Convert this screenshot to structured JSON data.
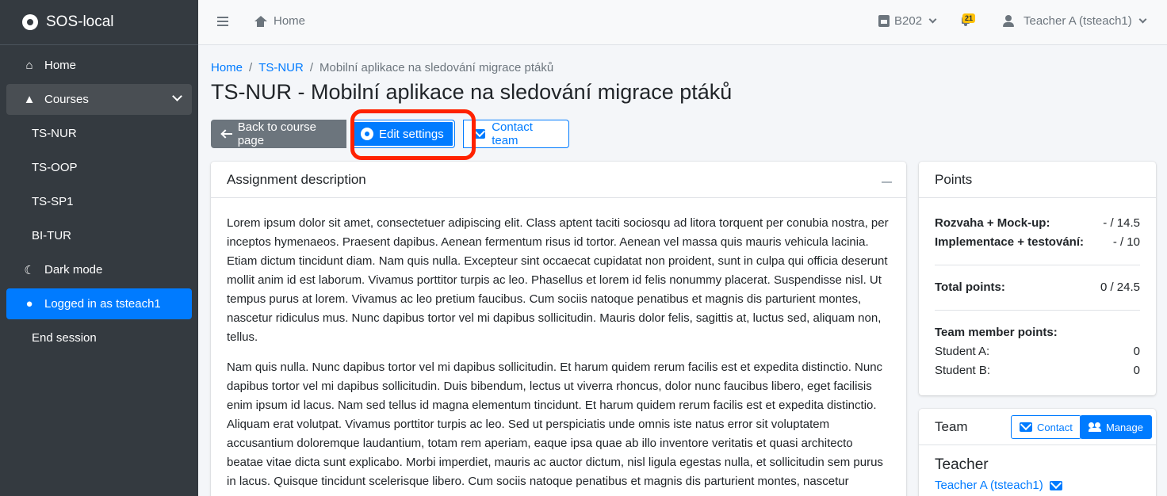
{
  "app": {
    "name": "SOS-local"
  },
  "sidebar": {
    "items": [
      {
        "label": "Home",
        "icon": "home-icon"
      },
      {
        "label": "Courses",
        "icon": "graduation-cap-icon"
      },
      {
        "label": "TS-NUR"
      },
      {
        "label": "TS-OOP"
      },
      {
        "label": "TS-SP1"
      },
      {
        "label": "BI-TUR"
      },
      {
        "label": "Dark mode",
        "icon": "moon-icon"
      },
      {
        "label": "Logged in as tsteach1",
        "icon": "user-cog-icon"
      },
      {
        "label": "End session"
      }
    ]
  },
  "topbar": {
    "home_label": "Home",
    "classroom": "B202",
    "notification_count": "21",
    "user_label": "Teacher A (tsteach1)"
  },
  "breadcrumb": {
    "items": [
      "Home",
      "TS-NUR",
      "Mobilní aplikace na sledování migrace ptáků"
    ],
    "separator": "/"
  },
  "page": {
    "title": "TS-NUR - Mobilní aplikace na sledování migrace ptáků",
    "back_label": "Back to course page",
    "edit_label": "Edit settings",
    "contact_label": "Contact team"
  },
  "assignment": {
    "header": "Assignment description",
    "paragraphs": [
      "Lorem ipsum dolor sit amet, consectetuer adipiscing elit. Class aptent taciti sociosqu ad litora torquent per conubia nostra, per inceptos hymenaeos. Praesent dapibus. Aenean fermentum risus id tortor. Aenean vel massa quis mauris vehicula lacinia. Etiam dictum tincidunt diam. Nam quis nulla. Excepteur sint occaecat cupidatat non proident, sunt in culpa qui officia deserunt mollit anim id est laborum. Vivamus porttitor turpis ac leo. Phasellus et lorem id felis nonummy placerat. Suspendisse nisl. Ut tempus purus at lorem. Vivamus ac leo pretium faucibus. Cum sociis natoque penatibus et magnis dis parturient montes, nascetur ridiculus mus. Nunc dapibus tortor vel mi dapibus sollicitudin. Mauris dolor felis, sagittis at, luctus sed, aliquam non, tellus.",
      "Nam quis nulla. Nunc dapibus tortor vel mi dapibus sollicitudin. Et harum quidem rerum facilis est et expedita distinctio. Nunc dapibus tortor vel mi dapibus sollicitudin. Duis bibendum, lectus ut viverra rhoncus, dolor nunc faucibus libero, eget facilisis enim ipsum id lacus. Nam sed tellus id magna elementum tincidunt. Et harum quidem rerum facilis est et expedita distinctio. Aliquam erat volutpat. Vivamus porttitor turpis ac leo. Sed ut perspiciatis unde omnis iste natus error sit voluptatem accusantium doloremque laudantium, totam rem aperiam, eaque ipsa quae ab illo inventore veritatis et quasi architecto beatae vitae dicta sunt explicabo. Morbi imperdiet, mauris ac auctor dictum, nisl ligula egestas nulla, et sollicitudin sem purus in lacus. Quisque tincidunt scelerisque libero. Cum sociis natoque penatibus et magnis dis parturient montes, nascetur"
    ]
  },
  "points": {
    "header": "Points",
    "rows": [
      {
        "label": "Rozvaha + Mock-up:",
        "value": "- / 14.5"
      },
      {
        "label": "Implementace + testování:",
        "value": "- / 10"
      }
    ],
    "total_label": "Total points:",
    "total_value": "0 / 24.5",
    "members_label": "Team member points:",
    "members": [
      {
        "label": "Student A:",
        "value": "0"
      },
      {
        "label": "Student B:",
        "value": "0"
      }
    ]
  },
  "team": {
    "header": "Team",
    "contact_label": "Contact",
    "manage_label": "Manage",
    "teacher_heading": "Teacher",
    "teacher_name": "Teacher A (tsteach1)"
  },
  "colors": {
    "primary": "#007bff",
    "sidebar": "#343a40",
    "highlight": "#ff2200"
  }
}
